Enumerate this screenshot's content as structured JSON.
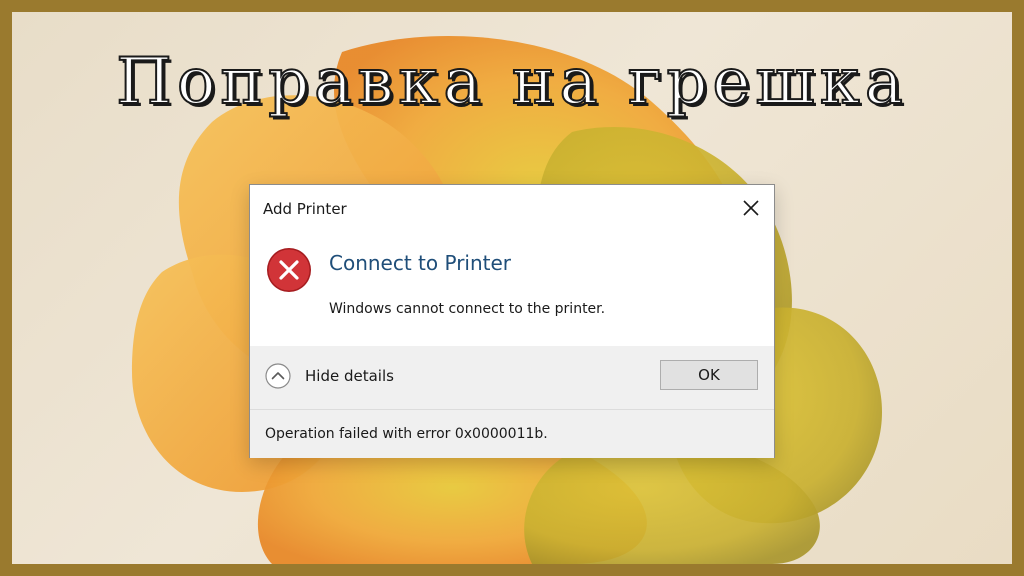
{
  "banner": {
    "headline": "Поправка на грешка"
  },
  "dialog": {
    "title": "Add Printer",
    "close_icon": "close-icon",
    "error_icon": "error-icon",
    "heading": "Connect to Printer",
    "message": "Windows cannot connect to the printer.",
    "details_toggle_label": "Hide details",
    "details_toggle_icon": "chevron-up-icon",
    "ok_label": "OK",
    "details_text": "Operation failed with error 0x0000011b."
  },
  "colors": {
    "frame_border": "#9a7a2e",
    "heading_blue": "#1f4e79",
    "error_red": "#d13438",
    "footer_gray": "#f0f0f0",
    "flower_orange": "#f2a43a",
    "flower_yellow": "#d9b92e"
  }
}
